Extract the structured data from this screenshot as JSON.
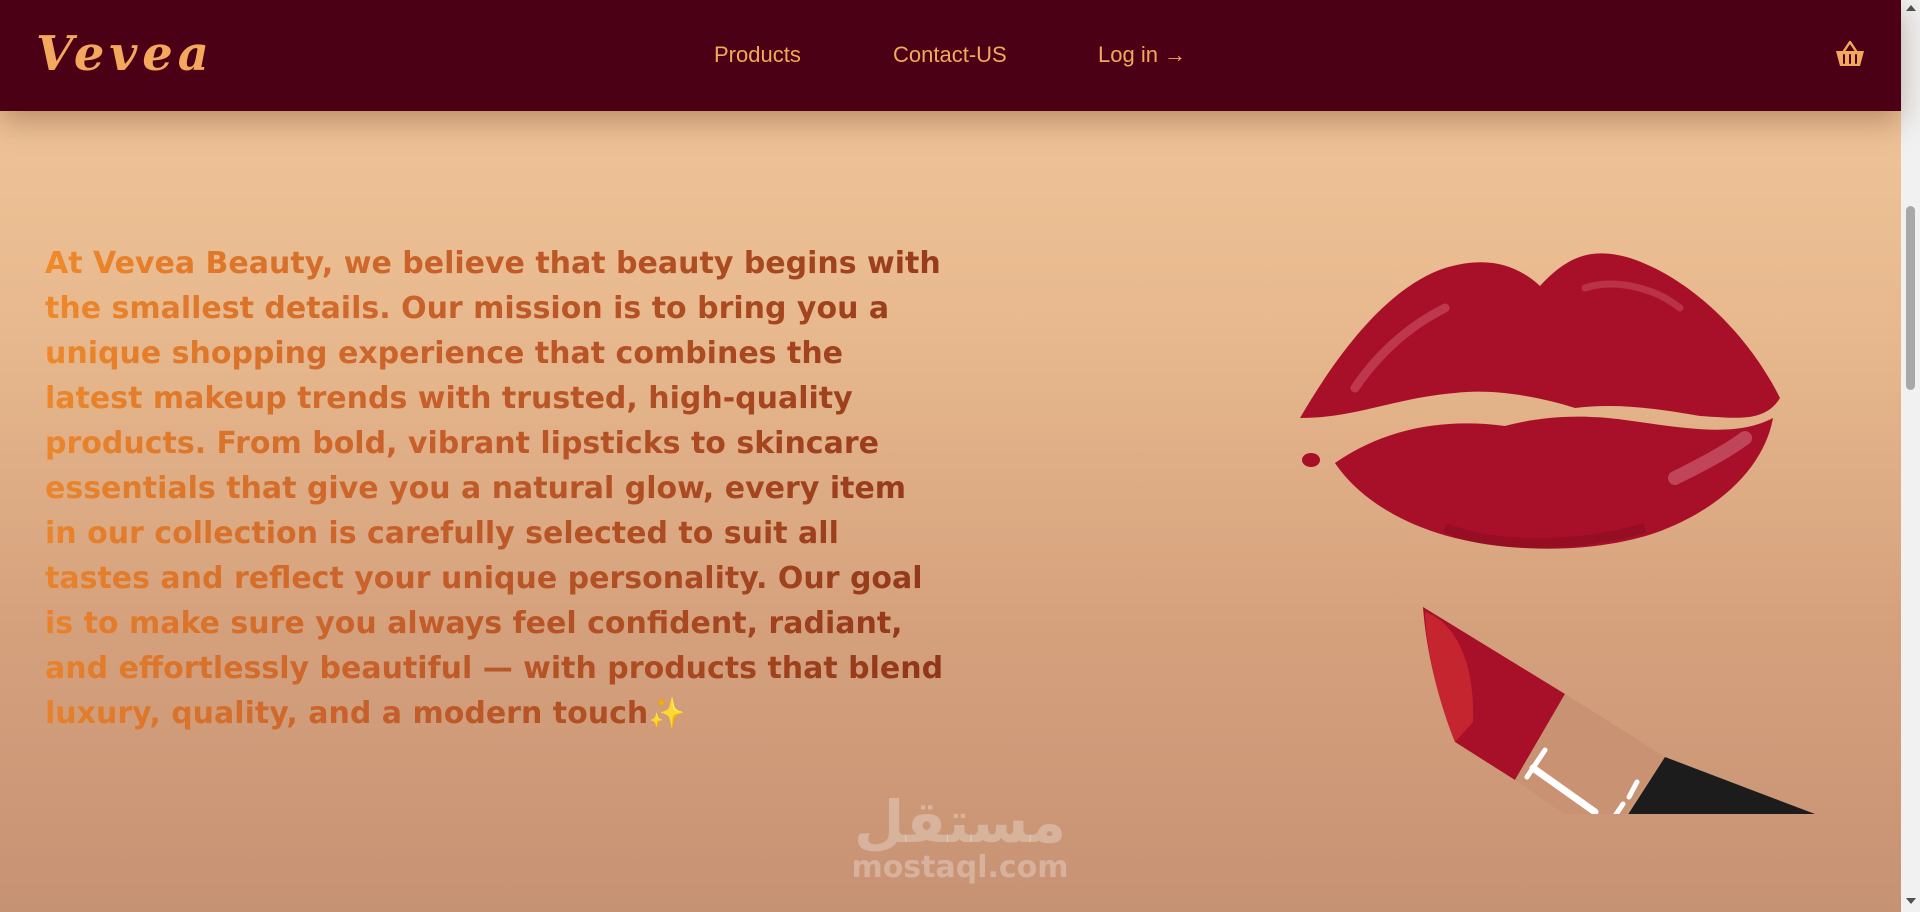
{
  "brand": {
    "logo_text": "Vevea"
  },
  "nav": {
    "products": "Products",
    "contact": "Contact-US",
    "login": "Log in →"
  },
  "cart": {
    "icon": "basket-icon"
  },
  "about": {
    "text": "At Vevea Beauty, we believe that beauty begins with the smallest details. Our mission is to bring you a unique shopping experience that combines the latest makeup trends with trusted, high-quality products. From bold, vibrant lipsticks to skincare essentials that give you a natural glow, every item in our collection is carefully selected to suit all tastes and reflect your unique personality. Our goal is to make sure you always feel confident, radiant, and effortlessly beautiful — with products that blend luxury, quality, and a modern touch",
    "sparkle": "✨"
  },
  "watermark": {
    "arabic": "مستقل",
    "latin": "mostaql.com"
  },
  "colors": {
    "navbar": "#4c0016",
    "accent": "#f3a85d",
    "lip_red": "#a8102a",
    "background_top": "#f2c89c",
    "background_bottom": "#c69274"
  }
}
